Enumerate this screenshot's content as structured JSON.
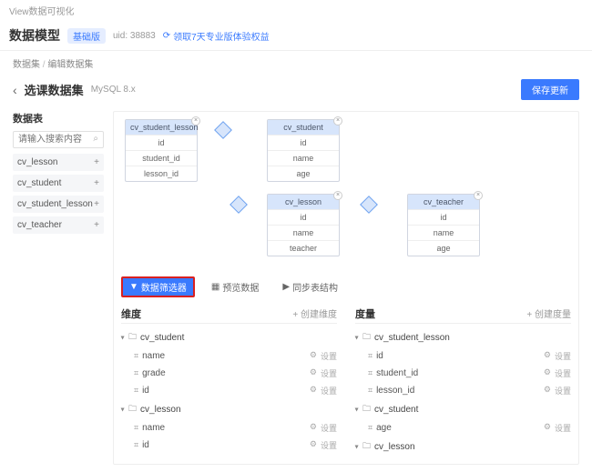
{
  "top": "View数据可视化",
  "hdr": {
    "title": "数据模型",
    "badge": "基础版",
    "uid": "uid: 38883",
    "link_icon": "⟳",
    "link": "领取7天专业版体验权益"
  },
  "crumb": [
    "数据集",
    "编辑数据集"
  ],
  "back_icon": "‹",
  "ds": {
    "name": "选课数据集",
    "ver": "MySQL 8.x",
    "save": "保存更新"
  },
  "side": {
    "title": "数据表",
    "placeholder": "请输入搜索内容",
    "search_icon": "⌕",
    "items": [
      "cv_lesson",
      "cv_student",
      "cv_student_lesson",
      "cv_teacher"
    ]
  },
  "diag": {
    "t1": {
      "name": "cv_student_lesson",
      "cols": [
        "id",
        "student_id",
        "lesson_id"
      ]
    },
    "t2": {
      "name": "cv_student",
      "cols": [
        "id",
        "name",
        "age"
      ]
    },
    "t3": {
      "name": "cv_lesson",
      "cols": [
        "id",
        "name",
        "teacher"
      ]
    },
    "t4": {
      "name": "cv_teacher",
      "cols": [
        "id",
        "name",
        "age"
      ]
    }
  },
  "tabs": {
    "filter_icon": "▼",
    "filter": "数据筛选器",
    "preview_icon": "▦",
    "preview": "预览数据",
    "sync_icon": "▶",
    "sync": "同步表结构"
  },
  "dim": {
    "title": "维度",
    "add": "+ 创建维度",
    "groups": [
      {
        "name": "cv_student",
        "fields": [
          "name",
          "grade",
          "id"
        ]
      },
      {
        "name": "cv_lesson",
        "fields": [
          "name",
          "id"
        ]
      }
    ]
  },
  "mea": {
    "title": "度量",
    "add": "+ 创建度量",
    "groups": [
      {
        "name": "cv_student_lesson",
        "fields": [
          "id",
          "student_id",
          "lesson_id"
        ]
      },
      {
        "name": "cv_student",
        "fields": [
          "age"
        ]
      },
      {
        "name": "cv_lesson",
        "fields": []
      }
    ]
  },
  "fld_actions": {
    "gear": "⚙",
    "cfg": "设置"
  },
  "folder_icon": "🗀",
  "hash_icon": "⌗",
  "close_x": "×",
  "plus": "+"
}
